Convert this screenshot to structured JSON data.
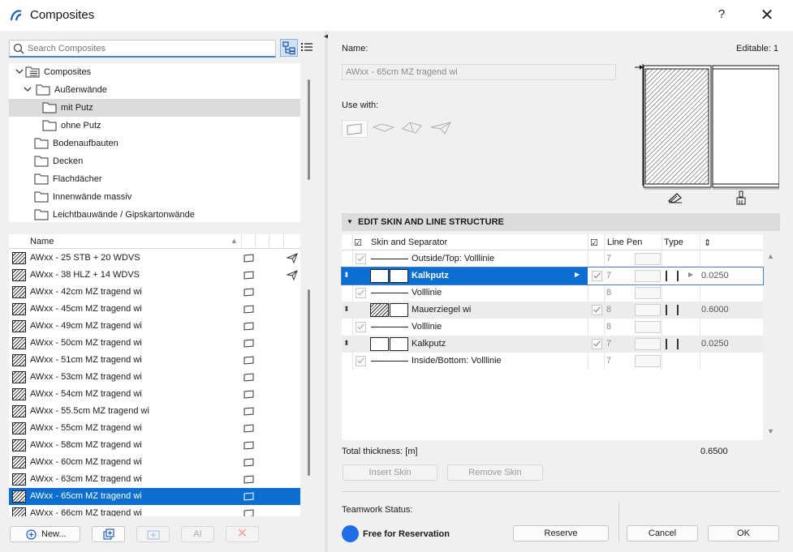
{
  "window": {
    "title": "Composites",
    "help": "?",
    "close": "✕"
  },
  "search": {
    "placeholder": "Search Composites"
  },
  "tree": [
    {
      "label": "Composites",
      "level": 0,
      "expanded": true,
      "icon": "composites-icon"
    },
    {
      "label": "Außenwände",
      "level": 1,
      "expanded": true,
      "icon": "folder-icon"
    },
    {
      "label": "mit Putz",
      "level": 2,
      "selected": true,
      "icon": "folder-icon"
    },
    {
      "label": "ohne Putz",
      "level": 2,
      "icon": "folder-icon"
    },
    {
      "label": "Bodenaufbauten",
      "level": 1,
      "icon": "folder-icon"
    },
    {
      "label": "Decken",
      "level": 1,
      "icon": "folder-icon"
    },
    {
      "label": "Flachdächer",
      "level": 1,
      "icon": "folder-icon"
    },
    {
      "label": "Innenwände massiv",
      "level": 1,
      "icon": "folder-icon"
    },
    {
      "label": "Leichtbauwände / Gipskartonwände",
      "level": 1,
      "icon": "folder-icon"
    }
  ],
  "list": {
    "header": "Name",
    "items": [
      {
        "name": "AWxx - 25 STB + 20 WDVS",
        "roof": true
      },
      {
        "name": "AWxx - 38 HLZ + 14 WDVS",
        "roof": true
      },
      {
        "name": "AWxx - 42cm MZ tragend wi"
      },
      {
        "name": "AWxx - 45cm MZ tragend wi"
      },
      {
        "name": "AWxx - 49cm MZ tragend wi"
      },
      {
        "name": "AWxx - 50cm MZ tragend wi"
      },
      {
        "name": "AWxx - 51cm MZ tragend wi"
      },
      {
        "name": "AWxx - 53cm MZ tragend wi"
      },
      {
        "name": "AWxx - 54cm MZ tragend wi"
      },
      {
        "name": "AWxx - 55.5cm MZ tragend wi"
      },
      {
        "name": "AWxx - 55cm MZ tragend wi"
      },
      {
        "name": "AWxx - 58cm MZ tragend wi"
      },
      {
        "name": "AWxx - 60cm MZ tragend wi"
      },
      {
        "name": "AWxx - 63cm MZ tragend wi"
      },
      {
        "name": "AWxx - 65cm MZ tragend wi",
        "selected": true
      },
      {
        "name": "AWxx - 66cm MZ tragend wi"
      }
    ]
  },
  "left_buttons": {
    "new_label": "New..."
  },
  "details": {
    "name_label": "Name:",
    "editable_label": "Editable: 1",
    "name_value": "AWxx - 65cm MZ tragend wi",
    "use_with_label": "Use with:"
  },
  "structure": {
    "section_title": "EDIT SKIN AND LINE STRUCTURE",
    "headers": {
      "skin": "Skin and Separator",
      "line_pen": "Line Pen",
      "type": "Type"
    },
    "rows": [
      {
        "kind": "line",
        "label": "Outside/Top: Volllinie",
        "pen": "7"
      },
      {
        "kind": "skin",
        "label": "Kalkputz",
        "pen": "7",
        "thickness": "0.0250",
        "selected": true
      },
      {
        "kind": "line",
        "label": "Volllinie",
        "pen": "8"
      },
      {
        "kind": "skin",
        "label": "Mauerziegel wi",
        "pen": "8",
        "thickness": "0.6000",
        "hatch": true
      },
      {
        "kind": "line",
        "label": "Volllinie",
        "pen": "8"
      },
      {
        "kind": "skin",
        "label": "Kalkputz",
        "pen": "7",
        "thickness": "0.0250"
      },
      {
        "kind": "line",
        "label": "Inside/Bottom: Volllinie",
        "pen": "7"
      }
    ],
    "total_label": "Total thickness: [m]",
    "total_value": "0.6500",
    "insert_label": "Insert Skin",
    "remove_label": "Remove Skin"
  },
  "teamwork": {
    "status_label": "Teamwork Status:",
    "status_value": "Free for Reservation",
    "status_color": "#1f6ee8",
    "reserve_label": "Reserve"
  },
  "footer": {
    "cancel_label": "Cancel",
    "ok_label": "OK"
  },
  "colors": {
    "selection": "#0a6fd1",
    "accent": "#1f6ee8"
  }
}
